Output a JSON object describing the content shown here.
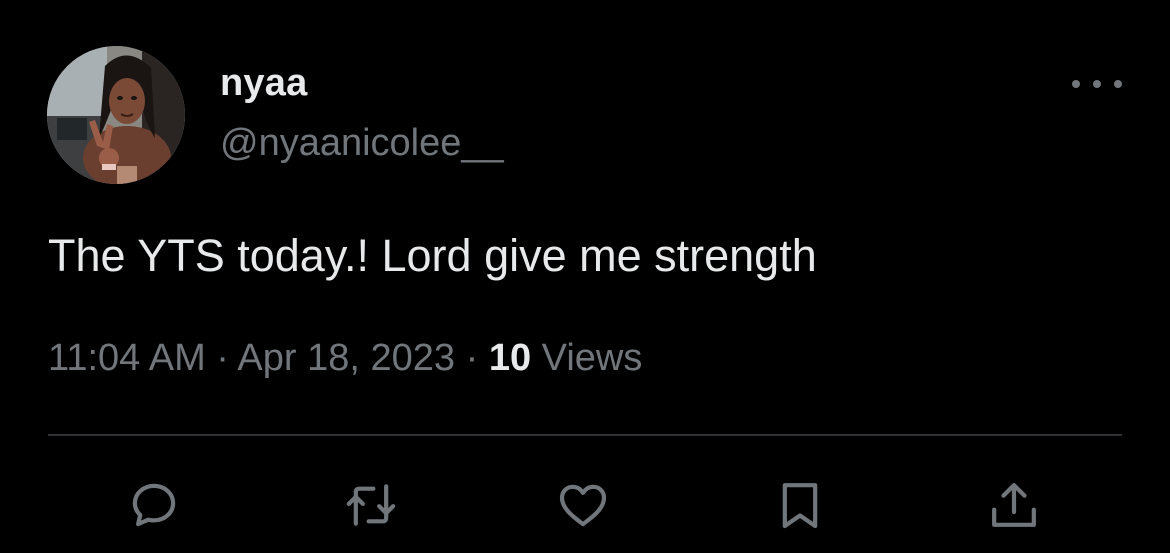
{
  "author": {
    "display_name": "nyaa",
    "handle": "@nyaanicolee__"
  },
  "tweet": {
    "text": "The YTS today.! Lord give me strength",
    "time": "11:04 AM",
    "separator": "·",
    "date": "Apr 18, 2023",
    "views_count": "10",
    "views_label": "Views"
  },
  "actions": [
    {
      "name": "reply",
      "icon": "reply-icon"
    },
    {
      "name": "retweet",
      "icon": "retweet-icon"
    },
    {
      "name": "like",
      "icon": "heart-icon"
    },
    {
      "name": "bookmark",
      "icon": "bookmark-icon"
    },
    {
      "name": "share",
      "icon": "share-icon"
    }
  ],
  "colors": {
    "background": "#000000",
    "primary_text": "#e7e9ea",
    "secondary_text": "#71767b",
    "divider": "#2f3336"
  }
}
